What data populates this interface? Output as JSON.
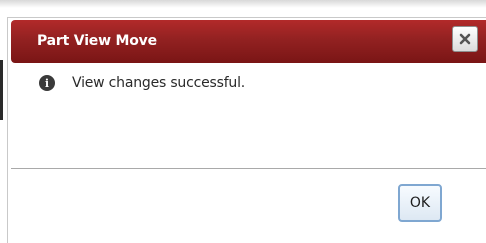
{
  "dialog": {
    "title": "Part View Move",
    "close_icon": "close-icon",
    "message_icon": "info-icon",
    "message": "View changes successful.",
    "ok_label": "OK"
  },
  "colors": {
    "titlebar": "#922121",
    "title_text": "#ffffff",
    "ok_border": "#7fa7d1"
  }
}
